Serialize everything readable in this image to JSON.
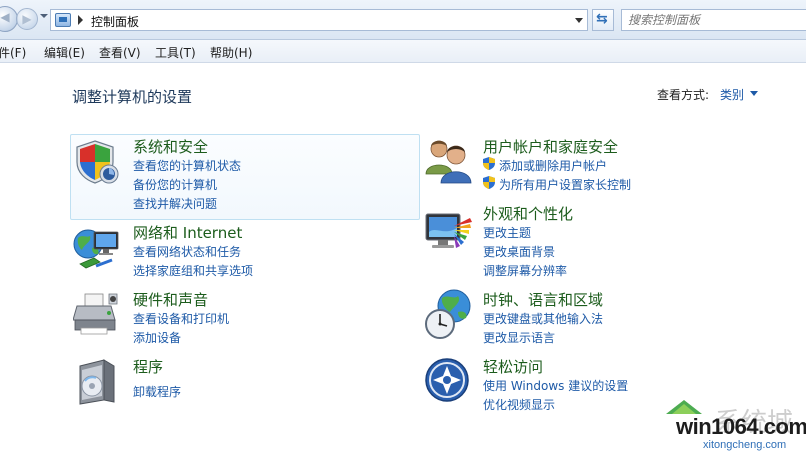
{
  "address": {
    "breadcrumb": "控制面板",
    "search_placeholder": "搜索控制面板"
  },
  "menu": [
    "件(F)",
    "编辑(E)",
    "查看(V)",
    "工具(T)",
    "帮助(H)"
  ],
  "page": {
    "title": "调整计算机的设置",
    "view_label": "查看方式:",
    "view_value": "类别"
  },
  "categories": {
    "security": {
      "title": "系统和安全",
      "links": [
        "查看您的计算机状态",
        "备份您的计算机",
        "查找并解决问题"
      ]
    },
    "user_accounts": {
      "title": "用户帐户和家庭安全",
      "links": [
        "添加或删除用户帐户",
        "为所有用户设置家长控制"
      ]
    },
    "network": {
      "title": "网络和 Internet",
      "links": [
        "查看网络状态和任务",
        "选择家庭组和共享选项"
      ]
    },
    "appearance": {
      "title": "外观和个性化",
      "links": [
        "更改主题",
        "更改桌面背景",
        "调整屏幕分辨率"
      ]
    },
    "hardware": {
      "title": "硬件和声音",
      "links": [
        "查看设备和打印机",
        "添加设备"
      ]
    },
    "clock": {
      "title": "时钟、语言和区域",
      "links": [
        "更改键盘或其他输入法",
        "更改显示语言"
      ]
    },
    "programs": {
      "title": "程序",
      "links": [
        "卸载程序"
      ]
    },
    "ease": {
      "title": "轻松访问",
      "links": [
        "使用 Windows 建议的设置",
        "优化视频显示"
      ]
    }
  },
  "watermark": {
    "text": "win1064.com",
    "big": "系统城",
    "sub": "xitongcheng.com"
  },
  "colors": {
    "title_green": "#1c5c1c",
    "link_blue": "#1e5aa7",
    "heading_blue": "#1e395b"
  }
}
